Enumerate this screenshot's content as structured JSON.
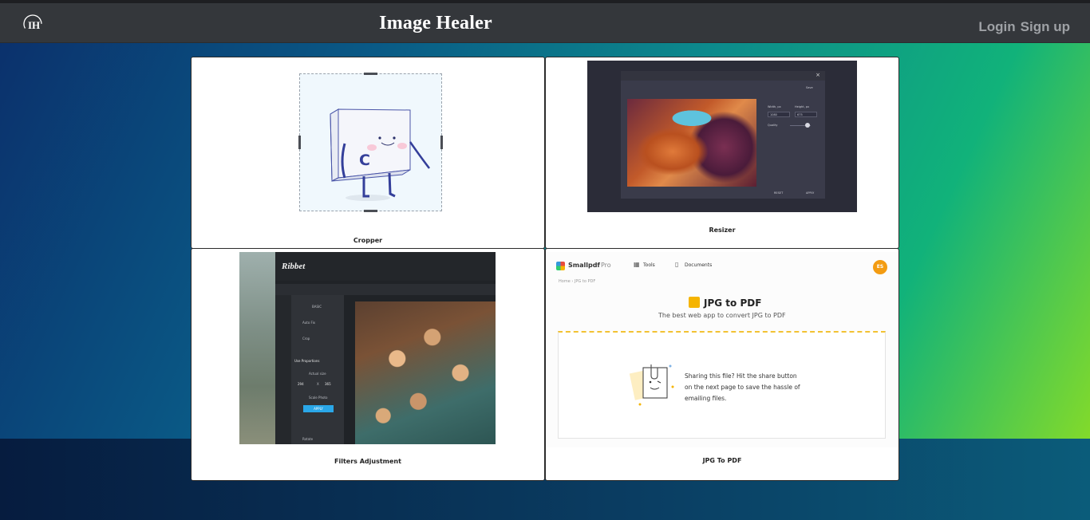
{
  "header": {
    "brand": "Image Healer",
    "logo_icon": "ih-logo-icon",
    "login_label": "Login",
    "signup_label": "Sign up"
  },
  "cards": [
    {
      "label": "Cropper",
      "thumb": "cropper-illustration"
    },
    {
      "label": "Resizer",
      "thumb": "resizer-screenshot",
      "screenshot": {
        "save": "Save",
        "width_label": "Width, px",
        "height_label": "Height, px",
        "width_value": "1080",
        "height_value": "675",
        "quality_label": "Quality",
        "reset": "RESET",
        "apply": "APPLY"
      }
    },
    {
      "label": "Filters Adjustment",
      "thumb": "filters-screenshot",
      "screenshot": {
        "app_name": "Ribbet",
        "section": "BASIC",
        "auto_fix": "Auto Fix",
        "crop": "Crop",
        "proportions": "Use Proportions",
        "actual_size": "Actual size",
        "w": "294",
        "x": "X",
        "h": "365",
        "scale_photo": "Scale Photo",
        "apply": "APPLY",
        "rotate": "Rotate"
      }
    },
    {
      "label": "JPG To PDF",
      "thumb": "jpg-to-pdf-screenshot",
      "screenshot": {
        "brand": "Smallpdf",
        "pro": "Pro",
        "tools": "Tools",
        "documents": "Documents",
        "avatar": "ES",
        "breadcrumb": "Home  ›  JPG to PDF",
        "title": "JPG to PDF",
        "subtitle": "The best web app to convert JPG to PDF",
        "message_lines": [
          "Sharing this file? Hit the share button",
          "on the next page to save the hassle of",
          "emailing files."
        ]
      }
    }
  ]
}
